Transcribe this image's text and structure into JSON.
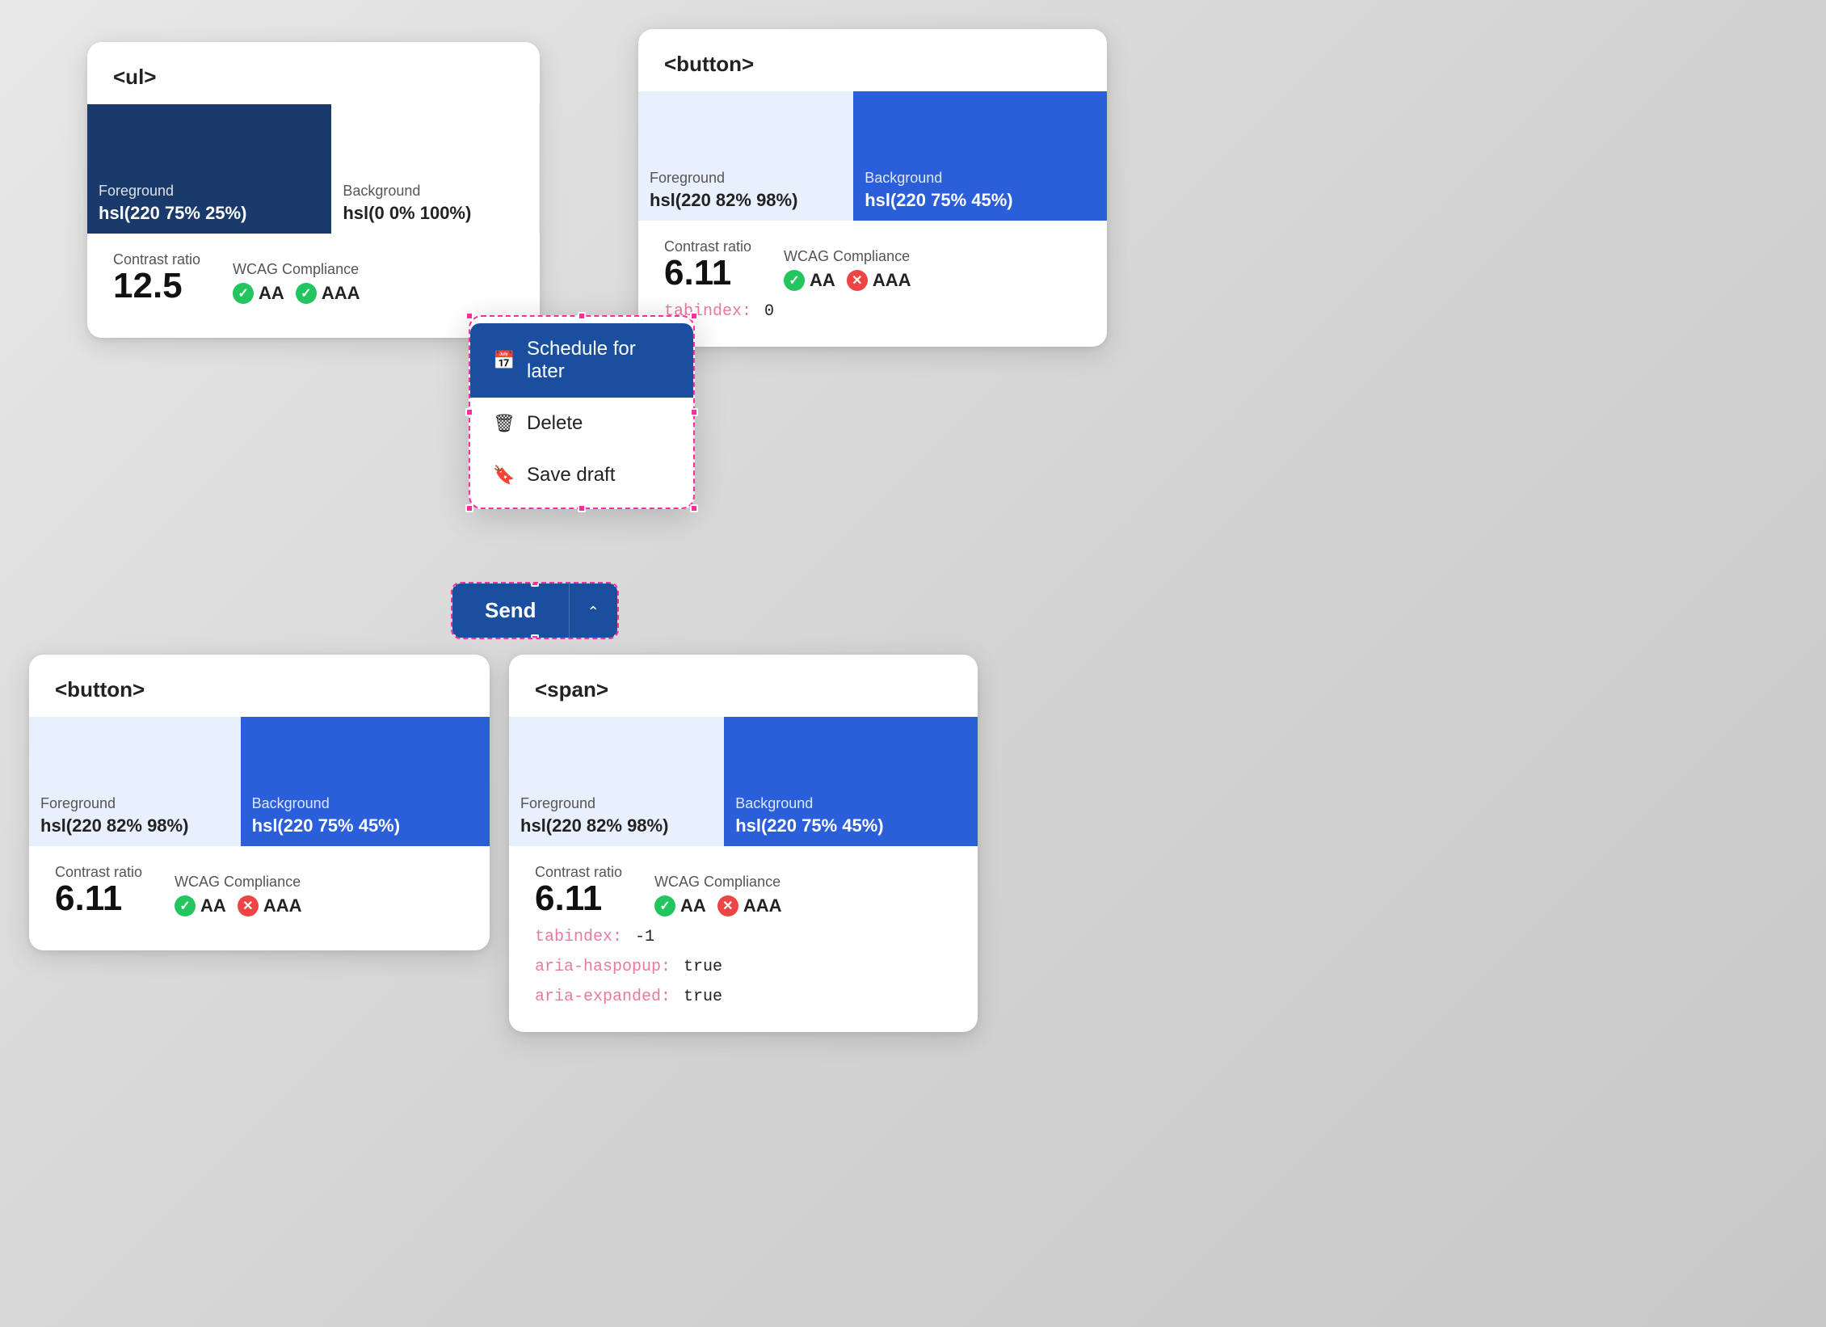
{
  "cards": {
    "ul": {
      "tag": "<ul>",
      "foreground_label": "Foreground",
      "foreground_value": "hsl(220 75% 25%)",
      "background_label": "Background",
      "background_value": "hsl(0 0% 100%)",
      "contrast_ratio_label": "Contrast ratio",
      "contrast_ratio_value": "12.5",
      "wcag_label": "WCAG Compliance",
      "badge_aa": "AA",
      "badge_aaa": "AAA",
      "swatch_fg_bg": "#1a3a6b",
      "swatch_bg_bg": "#ffffff"
    },
    "button_top": {
      "tag": "<button>",
      "foreground_label": "Foreground",
      "foreground_value": "hsl(220 82% 98%)",
      "background_label": "Background",
      "background_value": "hsl(220 75% 45%)",
      "contrast_ratio_label": "Contrast ratio",
      "contrast_ratio_value": "6.11",
      "wcag_label": "WCAG Compliance",
      "badge_aa": "AA",
      "badge_aaa": "AAA",
      "tabindex_key": "tabindex:",
      "tabindex_val": "0",
      "swatch_fg_bg": "#e8f0fe",
      "swatch_bg_bg": "#2b5fd9"
    },
    "button_bottom": {
      "tag": "<button>",
      "foreground_label": "Foreground",
      "foreground_value": "hsl(220 82% 98%)",
      "background_label": "Background",
      "background_value": "hsl(220 75% 45%)",
      "contrast_ratio_label": "Contrast ratio",
      "contrast_ratio_value": "6.11",
      "wcag_label": "WCAG Compliance",
      "badge_aa": "AA",
      "badge_aaa": "AAA",
      "swatch_fg_bg": "#e8f0fe",
      "swatch_bg_bg": "#2b5fd9"
    },
    "span": {
      "tag": "<span>",
      "foreground_label": "Foreground",
      "foreground_value": "hsl(220 82% 98%)",
      "background_label": "Background",
      "background_value": "hsl(220 75% 45%)",
      "contrast_ratio_label": "Contrast ratio",
      "contrast_ratio_value": "6.11",
      "wcag_label": "WCAG Compliance",
      "badge_aa": "AA",
      "badge_aaa": "AAA",
      "tabindex_key": "tabindex:",
      "tabindex_val": "-1",
      "aria_haspopup_key": "aria-haspopup:",
      "aria_haspopup_val": "true",
      "aria_expanded_key": "aria-expanded:",
      "aria_expanded_val": "true",
      "swatch_fg_bg": "#e8f0fe",
      "swatch_bg_bg": "#2b5fd9"
    }
  },
  "dropdown": {
    "schedule_label": "Schedule for later",
    "delete_label": "Delete",
    "save_draft_label": "Save draft"
  },
  "send_button": {
    "send_label": "Send",
    "chevron": "∧"
  }
}
